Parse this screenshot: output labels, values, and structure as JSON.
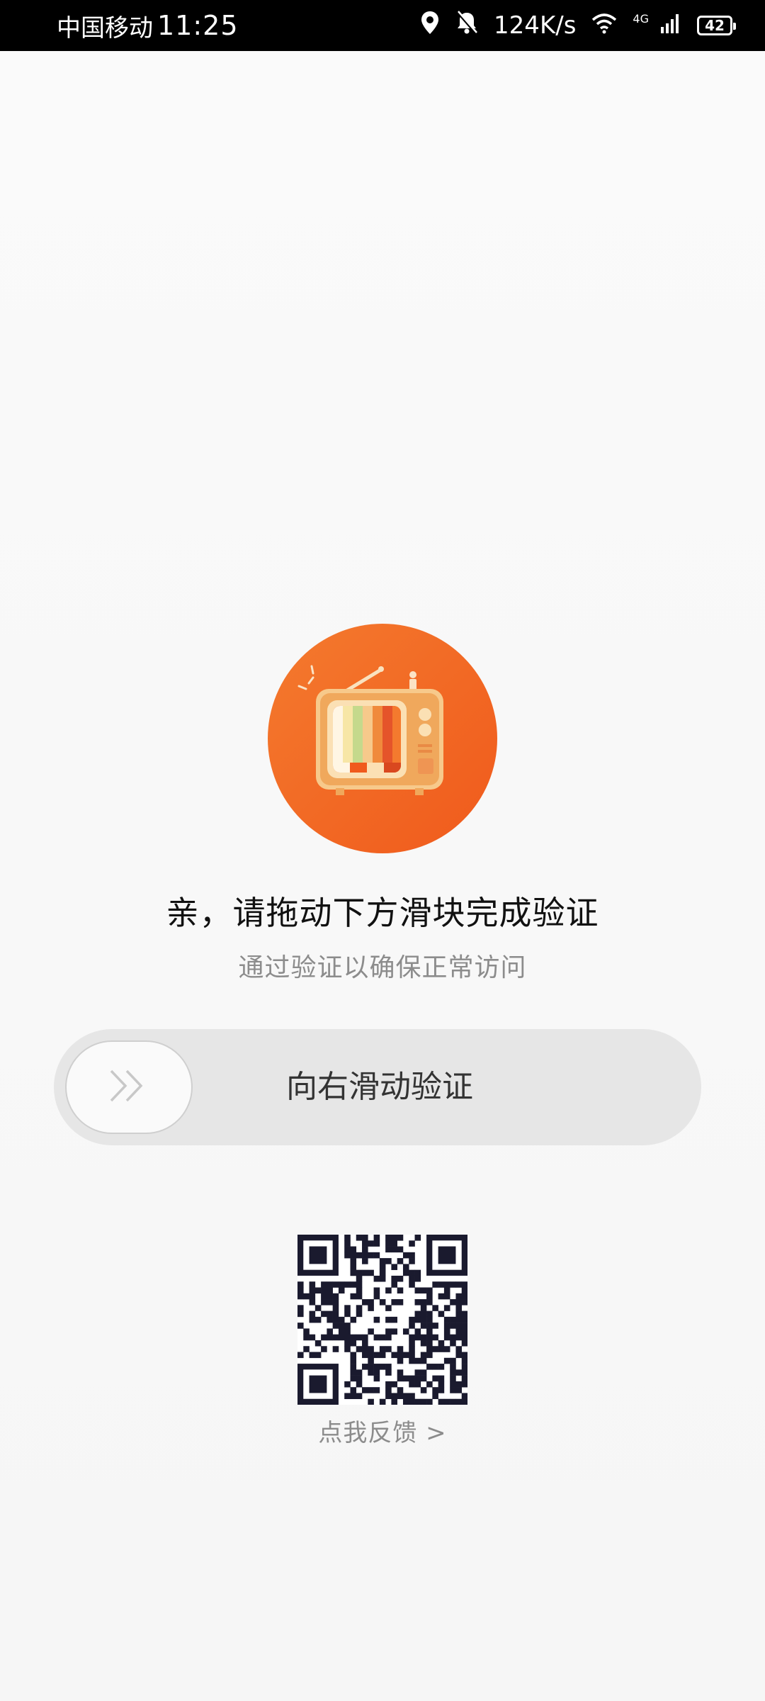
{
  "status_bar": {
    "carrier": "中国移动",
    "time": "11:25",
    "speed": "124K/s",
    "network": "4G",
    "battery": "42",
    "icons": [
      "location-icon",
      "bell-off-icon",
      "wifi-icon",
      "signal-icon",
      "battery-icon"
    ]
  },
  "verify": {
    "title": "亲，请拖动下方滑块完成验证",
    "subtitle": "通过验证以确保正常访问",
    "slider_label": "向右滑动验证",
    "slider_progress": 0
  },
  "feedback": {
    "label": "点我反馈 >"
  },
  "colors": {
    "accent_orange": "#f26b21",
    "track": "#e6e6e6",
    "muted_text": "#8c8c8c"
  }
}
